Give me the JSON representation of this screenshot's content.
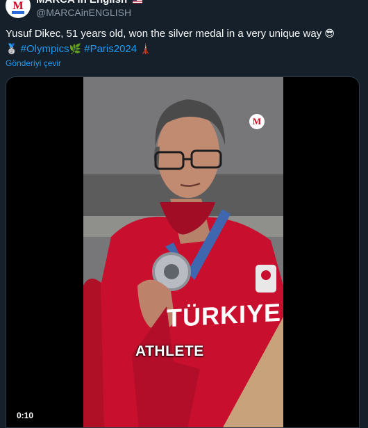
{
  "author": {
    "display_name": "MARCA in English",
    "handle": "@MARCAinENGLISH",
    "avatar_letter": "M"
  },
  "tweet": {
    "text_main": "Yusuf Dikec, 51 years old, won the silver medal in a very unique way",
    "emoji_sunglasses": "😎",
    "emoji_medal": "🥈",
    "hashtag_1": "#Olympics",
    "emoji_laurel": "🌿",
    "hashtag_2": "#Paris2024",
    "emoji_tower": "🗼",
    "translate_label": "Gönderiyi çevir"
  },
  "video": {
    "brand_badge": "M",
    "caption": "ATHLETE",
    "jersey_text": "TÜRKIYE",
    "timestamp": "0:10"
  },
  "colors": {
    "background": "#15202b",
    "link": "#1d9bf0",
    "jacket_red": "#c8102e"
  }
}
